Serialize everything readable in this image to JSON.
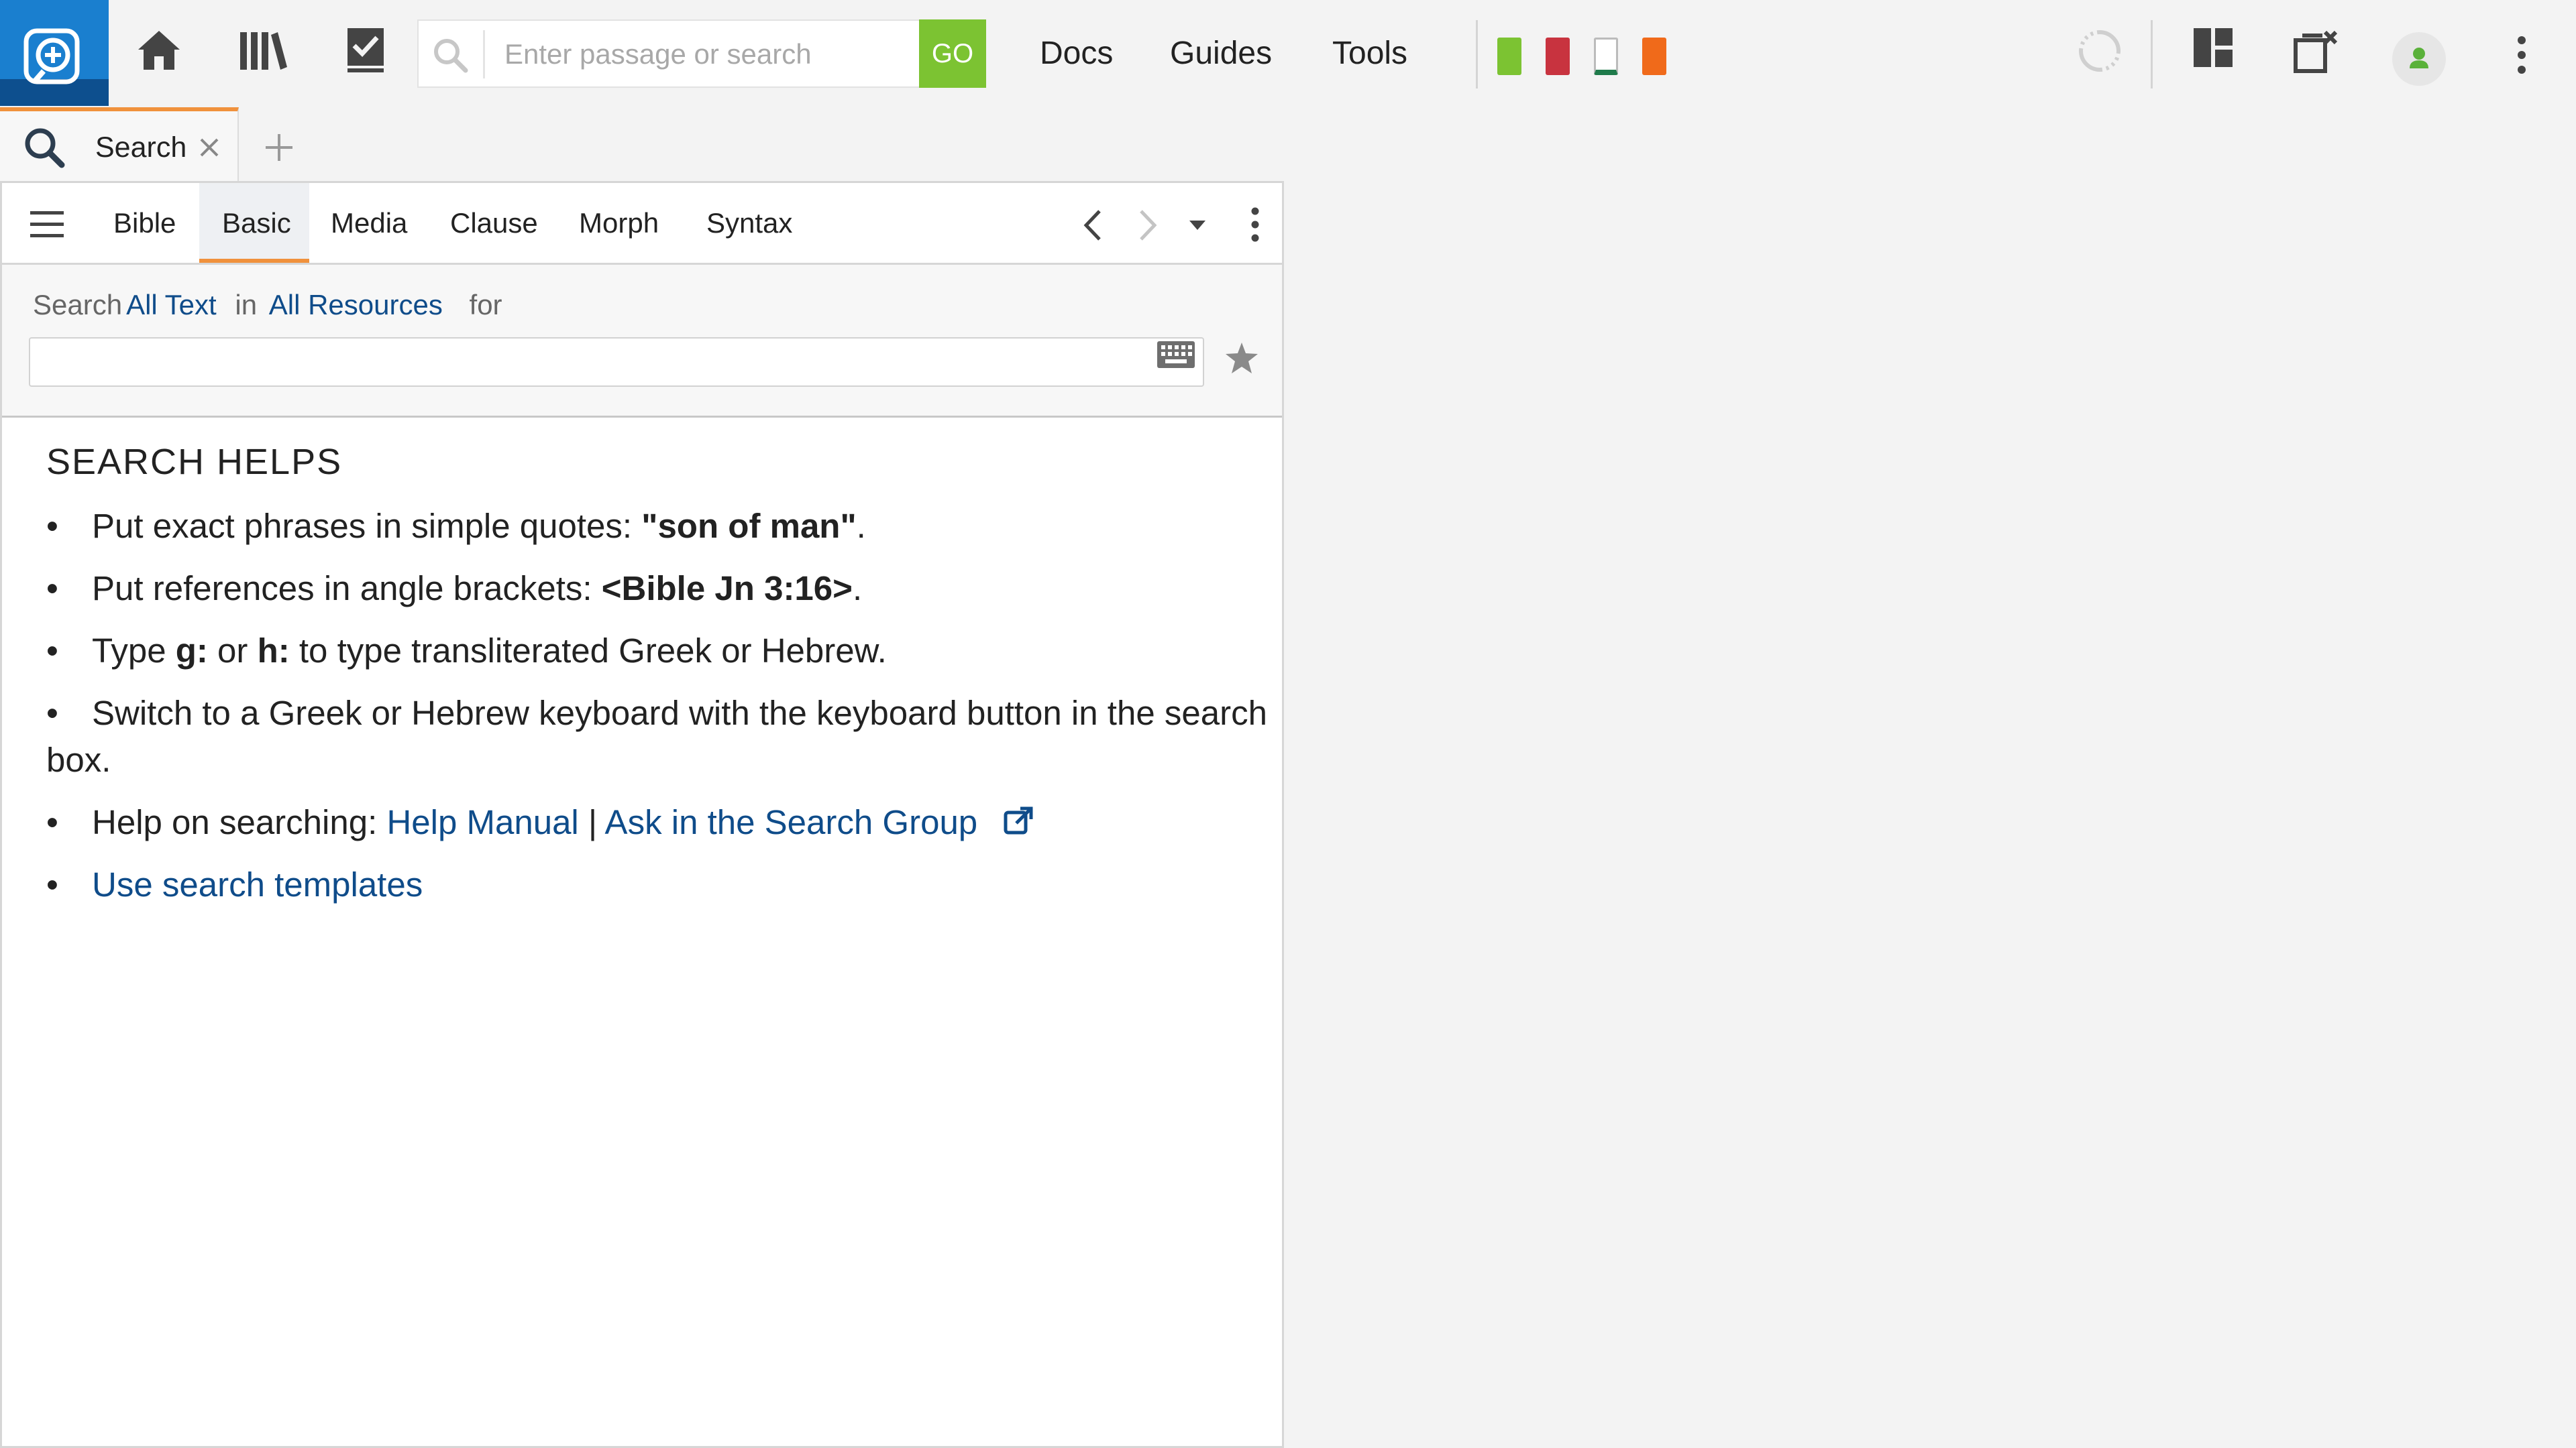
{
  "toolbar": {
    "search_placeholder": "Enter passage or search",
    "go_label": "GO",
    "menu": [
      "Docs",
      "Guides",
      "Tools"
    ]
  },
  "tabs": {
    "active_label": "Search"
  },
  "subtabs": [
    "Bible",
    "Basic",
    "Media",
    "Clause",
    "Morph",
    "Syntax"
  ],
  "query": {
    "search_word": "Search",
    "scope_link": "All Text",
    "in_word": "in",
    "resource_link": "All Resources",
    "for_word": "for",
    "input_value": ""
  },
  "helps": {
    "title": "SEARCH HELPS",
    "item1_pre": "Put exact phrases in simple quotes: ",
    "item1_bold": "\"son of man\"",
    "item1_post": ".",
    "item2_pre": "Put references in angle brackets: ",
    "item2_bold": "<Bible Jn 3:16>",
    "item2_post": ".",
    "item3_pre": "Type ",
    "item3_bold1": "g:",
    "item3_mid": " or ",
    "item3_bold2": "h:",
    "item3_post": " to type transliterated Greek or Hebrew.",
    "item4": "Switch to a Greek or Hebrew keyboard with the keyboard button in the search box.",
    "item5_pre": "Help on searching: ",
    "item5_link1": "Help Manual",
    "item5_sep": " | ",
    "item5_link2": "Ask in the Search Group",
    "item6_link": "Use search templates",
    "bullet": "•"
  },
  "colors": {
    "accent_orange": "#f0913c",
    "go_green": "#7cc332",
    "logo_blue": "#1a7fcf",
    "link_blue": "#0f4c8a"
  },
  "icons": [
    "logo-icon",
    "home-icon",
    "library-icon",
    "checklist-icon",
    "search-icon",
    "sync-icon",
    "layout-icon",
    "close-panels-icon",
    "user-icon",
    "more-icon",
    "hamburger-icon",
    "keyboard-icon",
    "star-icon",
    "external-link-icon"
  ]
}
